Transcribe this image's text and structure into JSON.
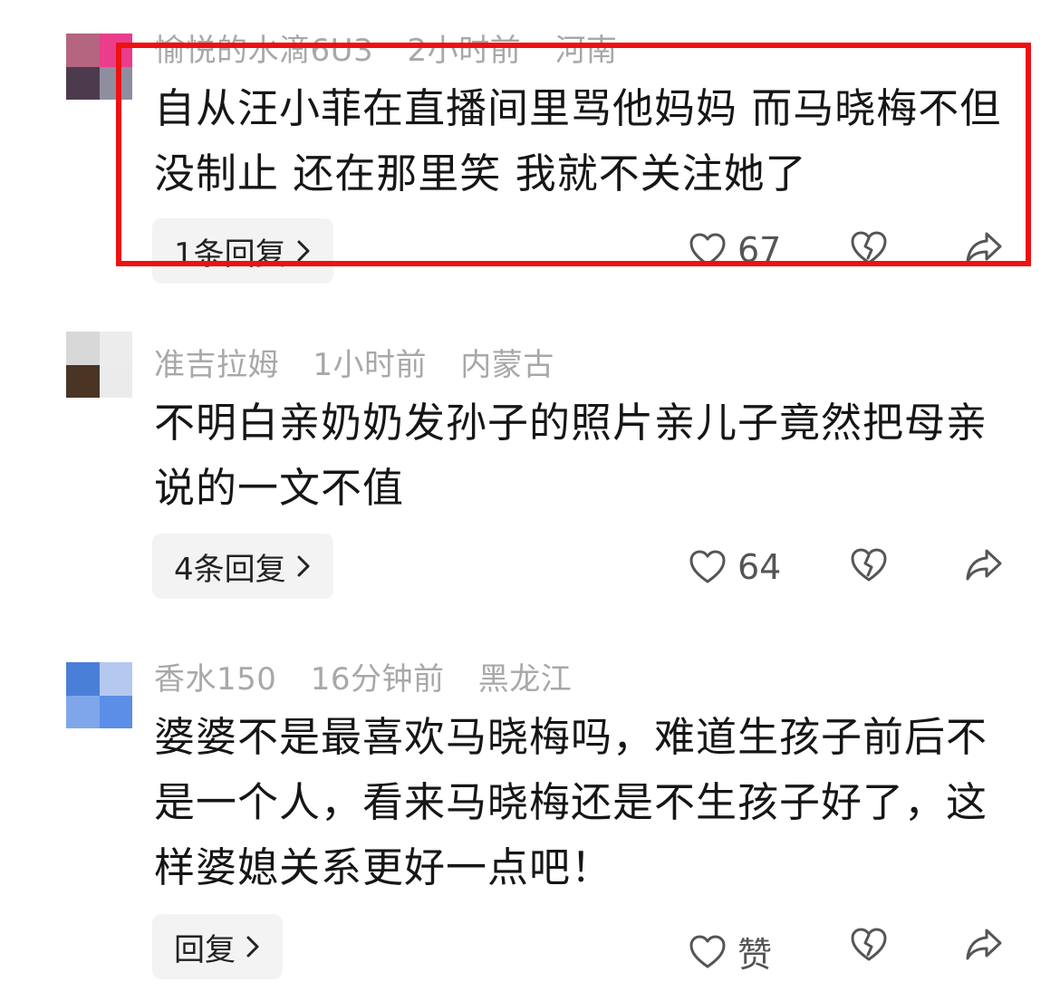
{
  "comments": [
    {
      "username": "愉悦的水滴6U3",
      "time": "2小时前",
      "location": "河南",
      "text": "自从汪小菲在直播间里骂他妈妈 而马晓梅不但没制止 还在那里笑 我就不关注她了",
      "reply_label": "1条回复",
      "like_count": "67",
      "avatar_colors": [
        "#b4657f",
        "#ea3d8c",
        "#4c3b4c",
        "#8f8e9f"
      ]
    },
    {
      "username": "准吉拉姆",
      "time": "1小时前",
      "location": "内蒙古",
      "text": "不明白亲奶奶发孙子的照片亲儿子竟然把母亲说的一文不值",
      "reply_label": "4条回复",
      "like_count": "64",
      "avatar_colors": [
        "#d8d8d8",
        "#ececec",
        "#4a3424",
        "#ebebeb"
      ]
    },
    {
      "username": "香水150",
      "time": "16分钟前",
      "location": "黑龙江",
      "text": "婆婆不是最喜欢马晓梅吗，难道生孩子前后不是一个人，看来马晓梅还是不生孩子好了，这样婆媳关系更好一点吧！",
      "reply_label": "回复",
      "like_count": "赞",
      "avatar_colors": [
        "#4a7fd8",
        "#b5c9f0",
        "#7fa6eb",
        "#5b8ee6"
      ]
    }
  ],
  "highlight_color": "#ee1111",
  "icons": {
    "like": "heart-outline-icon",
    "dislike": "broken-heart-icon",
    "share": "share-arrow-icon",
    "chevron": "chevron-right-icon"
  }
}
